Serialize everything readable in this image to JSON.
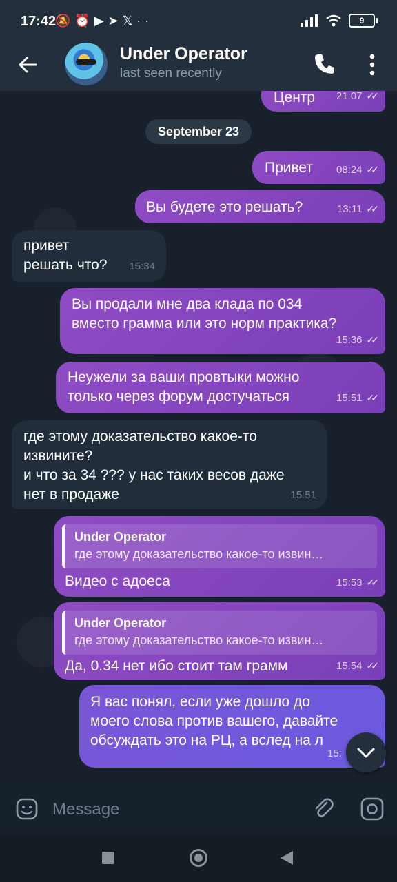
{
  "status_bar": {
    "time": "17:42",
    "icons": [
      "mute-icon",
      "alarm-icon",
      "youtube-icon",
      "telegram-icon",
      "x-icon",
      "more-dots-icon"
    ],
    "battery": "9"
  },
  "header": {
    "title": "Under Operator",
    "subtitle": "last seen recently"
  },
  "chat": {
    "date_separator": "September 23",
    "messages": [
      {
        "dir": "out",
        "text": "Центр",
        "time": "21:07"
      },
      {
        "dir": "out",
        "text": "Привет",
        "time": "08:24"
      },
      {
        "dir": "out",
        "text": "Вы будете это решать?",
        "time": "13:11"
      },
      {
        "dir": "in",
        "line1": "привет",
        "line2": "решать что?",
        "time": "15:34"
      },
      {
        "dir": "out",
        "line1": "Вы продали мне два клада по 034",
        "line2": "вместо грамма или это норм практика?",
        "time": "15:36"
      },
      {
        "dir": "out",
        "line1": "Неужели за ваши провтыки можно",
        "line2": "только через форум достучаться",
        "time": "15:51"
      },
      {
        "dir": "in",
        "line1": "где этому доказательство какое-то",
        "line2": "извините?",
        "line3": "и что за 34 ??? у нас таких весов даже",
        "line4": "нет в продаже",
        "time": "15:51"
      },
      {
        "dir": "out",
        "reply_name": "Under Operator",
        "reply_text": "где этому доказательство какое-то извин…",
        "text": "Видео с адоеса",
        "time": "15:53"
      },
      {
        "dir": "out",
        "reply_name": "Under Operator",
        "reply_text": "где этому доказательство какое-то извин…",
        "text": "Да, 0.34 нет ибо стоит там грамм",
        "time": "15:54"
      },
      {
        "dir": "out",
        "line1": "Я вас понял, если уже дошло до",
        "line2": "моего слова против вашего, давайте",
        "line3": "обсуждать это на РЦ, а вслед на л",
        "time": "15:"
      }
    ]
  },
  "input": {
    "placeholder": "Message"
  },
  "colors": {
    "outgoing_bubble": "#8f4cc4",
    "incoming_bubble": "#212d3b",
    "background": "#17202b",
    "header": "#242f3d"
  }
}
